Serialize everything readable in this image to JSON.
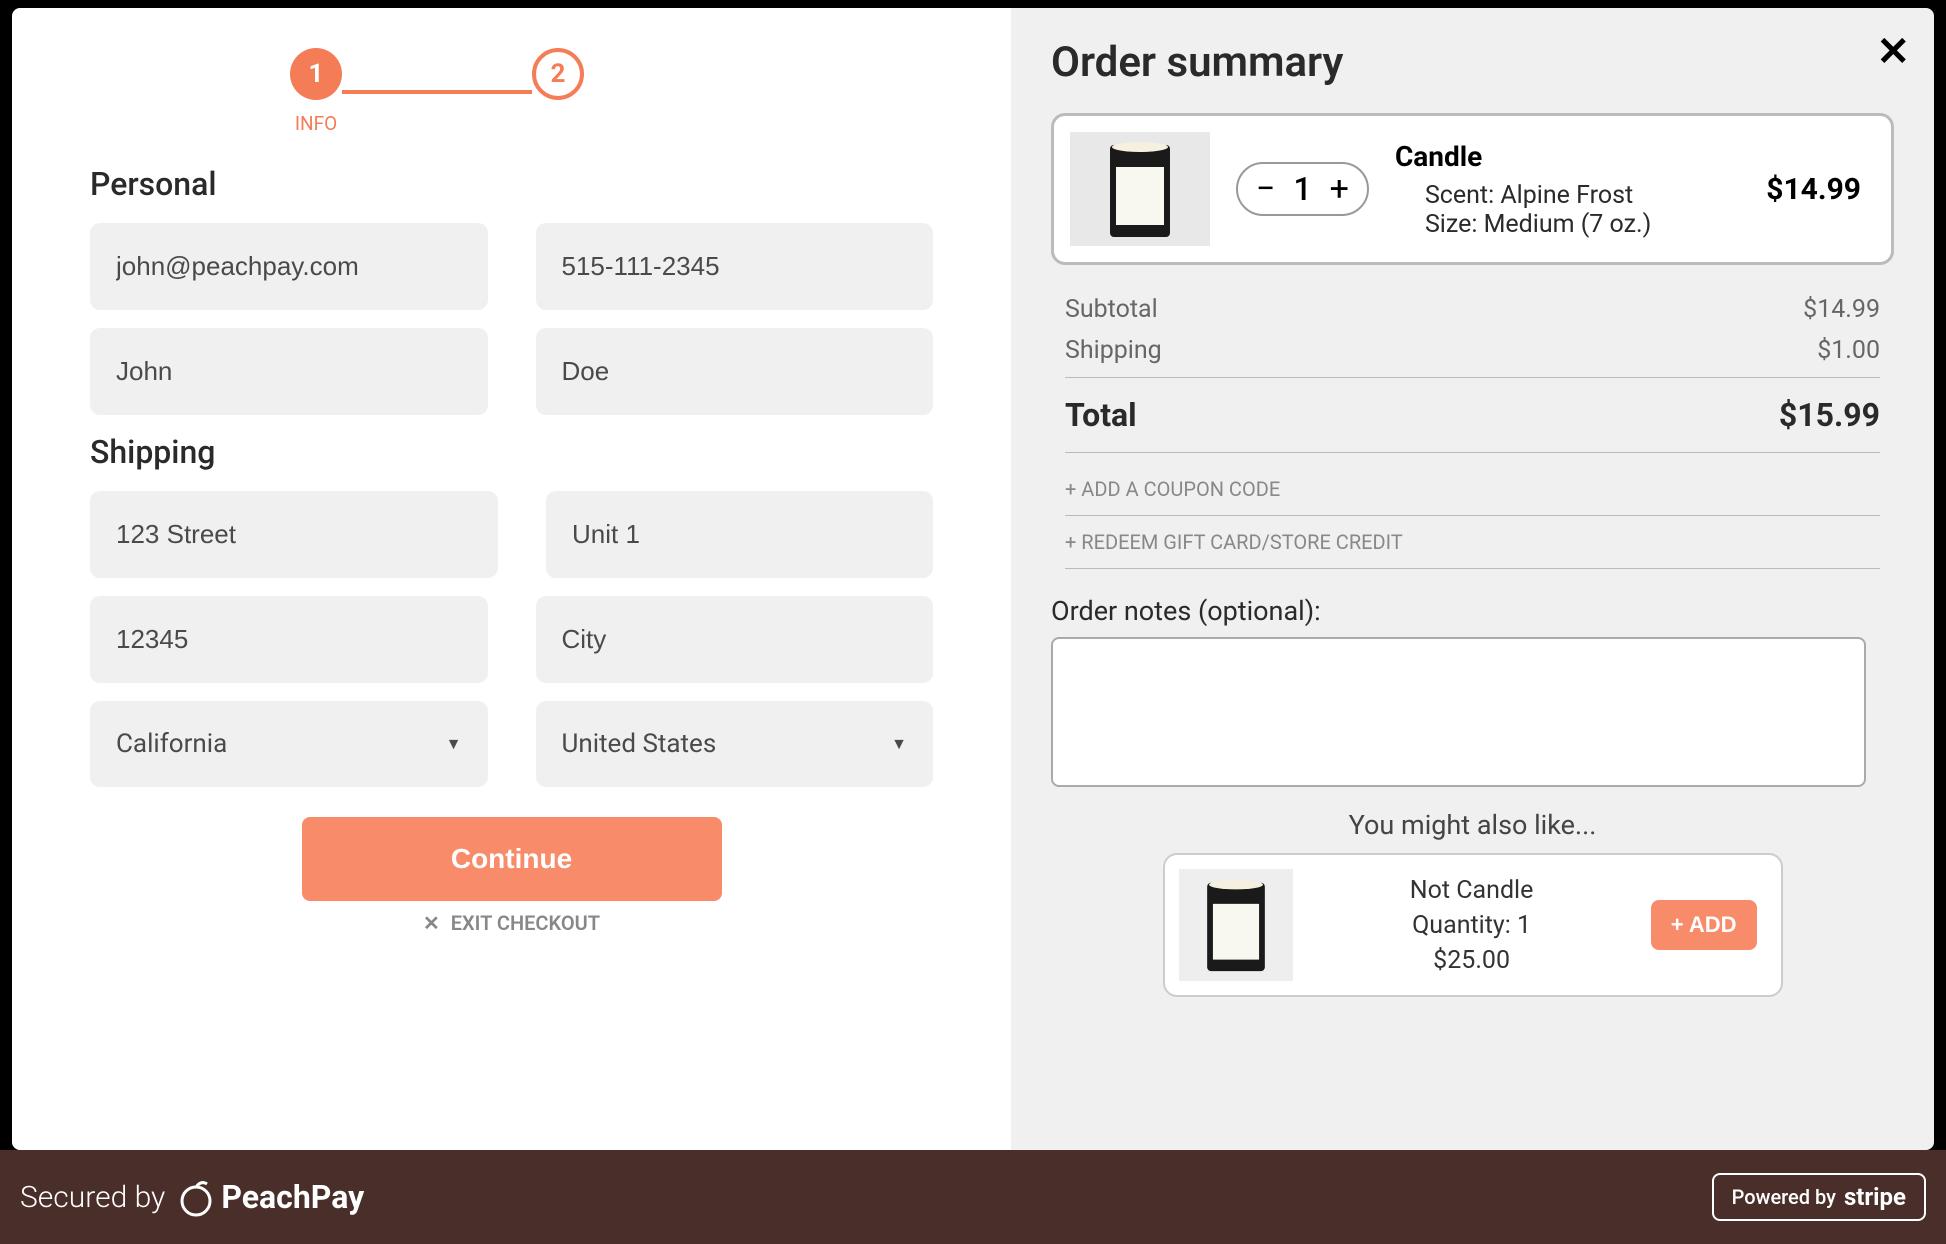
{
  "stepper": {
    "step1_num": "1",
    "step2_num": "2",
    "step1_label": "INFO"
  },
  "sections": {
    "personal": "Personal",
    "shipping": "Shipping"
  },
  "personal": {
    "email": "john@peachpay.com",
    "phone": "515-111-2345",
    "first_name": "John",
    "last_name": "Doe"
  },
  "shipping": {
    "street": "123 Street",
    "unit": "Unit 1",
    "postal": "12345",
    "city": "City",
    "state": "California",
    "country": "United States"
  },
  "actions": {
    "continue": "Continue",
    "exit": "EXIT CHECKOUT"
  },
  "order": {
    "title": "Order summary",
    "item": {
      "name": "Candle",
      "qty": "1",
      "scent": "Scent: Alpine Frost",
      "size": "Size: Medium (7 oz.)",
      "price": "$14.99"
    },
    "subtotal_label": "Subtotal",
    "subtotal": "$14.99",
    "shipping_label": "Shipping",
    "shipping": "$1.00",
    "total_label": "Total",
    "total": "$15.99",
    "coupon_link": "+ ADD A COUPON CODE",
    "giftcard_link": "+ REDEEM GIFT CARD/STORE CREDIT",
    "notes_label": "Order notes (optional):",
    "suggest_title": "You might also like...",
    "suggest": {
      "name": "Not Candle",
      "qty": "Quantity: 1",
      "price": "$25.00",
      "add": "+ ADD"
    }
  },
  "footer": {
    "secured": "Secured by",
    "brand": "PeachPay",
    "powered": "Powered by",
    "stripe": "stripe"
  }
}
